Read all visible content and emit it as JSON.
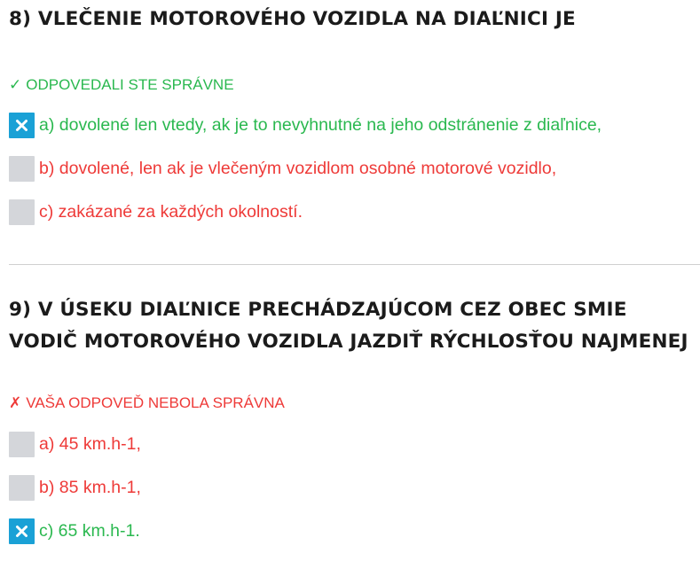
{
  "questions": [
    {
      "title": "8) VLEČENIE MOTOROVÉHO VOZIDLA NA DIAĽNICI JE",
      "result": {
        "glyph": "✓",
        "text": "ODPOVEDALI STE SPRÁVNE",
        "status": "correct",
        "color": "#2ab84f"
      },
      "answers": [
        {
          "text": "a) dovolené len vtedy, ak je to nevyhnutné na jeho odstránenie z diaľnice,",
          "checked": true,
          "color": "#2ab84f",
          "icon": "x-mark-icon"
        },
        {
          "text": "b) dovolené, len ak je vlečeným vozidlom osobné motorové vozidlo,",
          "checked": false,
          "color": "#ee3a38",
          "icon": ""
        },
        {
          "text": "c) zakázané za každých okolností.",
          "checked": false,
          "color": "#ee3a38",
          "icon": ""
        }
      ]
    },
    {
      "title": "9) V ÚSEKU DIAĽNICE PRECHÁDZAJÚCOM CEZ OBEC SMIE VODIČ MOTOROVÉHO VOZIDLA JAZDIŤ RÝCHLOSŤOU NAJMENEJ",
      "result": {
        "glyph": "✗",
        "text": "VAŠA ODPOVEĎ NEBOLA SPRÁVNA",
        "status": "incorrect",
        "color": "#ee3a38"
      },
      "answers": [
        {
          "text": "a) 45 km.h-1,",
          "checked": false,
          "color": "#ee3a38",
          "icon": ""
        },
        {
          "text": "b) 85 km.h-1,",
          "checked": false,
          "color": "#ee3a38",
          "icon": ""
        },
        {
          "text": "c) 65 km.h-1.",
          "checked": true,
          "color": "#2ab84f",
          "icon": "x-mark-icon"
        }
      ]
    }
  ],
  "colors": {
    "checkbox_checked": "#1aa1d6",
    "checkbox_unchecked": "#d4d6da",
    "title": "#1b1b1b",
    "divider": "#d0d0d0"
  }
}
